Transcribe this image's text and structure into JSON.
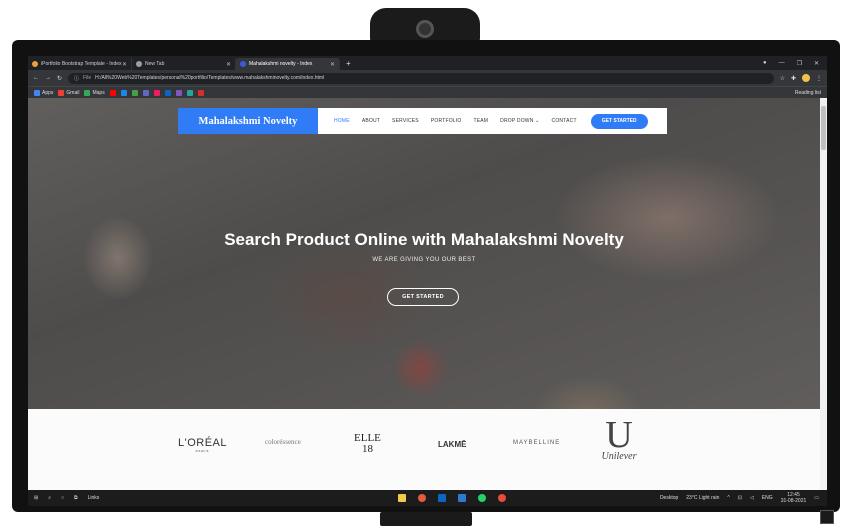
{
  "browser": {
    "tabs": [
      {
        "title": "iPortfolio Bootstrap Template - Index",
        "icon": "portfolio-favicon-icon"
      },
      {
        "title": "New Tab",
        "icon": "chrome-favicon-icon"
      },
      {
        "title": "Mahalakshmi novelty - Index",
        "icon": "m-favicon-icon",
        "active": true
      }
    ],
    "new_tab": "+",
    "window_controls": [
      "—",
      "❐",
      "✕"
    ],
    "address": {
      "scheme": "File",
      "url": "H:/All%20Web%20Templates/personal%20portfilio/Templates/www.mahalakshminovelty.com/index.html"
    },
    "bookmarks": [
      {
        "label": "Apps",
        "color": "#4285f4"
      },
      {
        "label": "Gmail",
        "color": "#ea4335"
      },
      {
        "label": "Maps",
        "color": "#34a853"
      },
      {
        "label": "",
        "color": "#ff0000"
      },
      {
        "label": "",
        "color": "#1e88e5"
      },
      {
        "label": "",
        "color": "#43a047"
      },
      {
        "label": "",
        "color": "#5c6bc0"
      },
      {
        "label": "",
        "color": "#e91e63"
      },
      {
        "label": "",
        "color": "#0a66c2"
      },
      {
        "label": "",
        "color": "#7e57c2"
      },
      {
        "label": "",
        "color": "#26a69a"
      },
      {
        "label": "",
        "color": "#d32f2f"
      }
    ],
    "reading_list": "Reading list"
  },
  "site": {
    "brand": "Mahalakshmi Novelty",
    "nav": [
      "HOME",
      "ABOUT",
      "SERVICES",
      "PORTFOLIO",
      "TEAM",
      "DROP DOWN ⌄",
      "CONTACT"
    ],
    "cta": "GET STARTED",
    "hero_title": "Search Product Online with Mahalakshmi Novelty",
    "hero_subtitle": "WE ARE GIVING YOU OUR BEST",
    "hero_button": "GET STARTED",
    "accent": "#2f7cf6",
    "brands": {
      "loreal": "L'ORÉAL",
      "loreal_sub": "PARIS",
      "coloressence": "coloréssence",
      "elle_top": "ELLE",
      "elle_bottom": "18",
      "lakme": "LAKMĒ",
      "maybelline": "MAYBELLINE",
      "unilever_mark": "U",
      "unilever": "Unilever"
    }
  },
  "taskbar": {
    "links": "Links",
    "desktop": "Desktop",
    "weather": "23°C  Light rain",
    "lang": "ENG",
    "time": "12:45",
    "date": "31-08-2021"
  }
}
